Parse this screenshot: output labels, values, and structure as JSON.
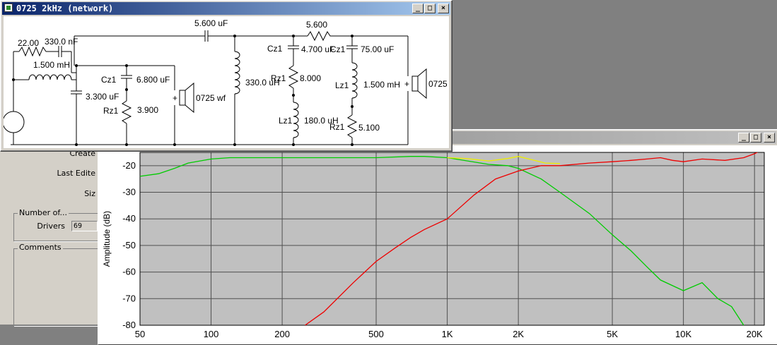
{
  "network_window": {
    "title": "0725 2kHz (network)",
    "buttons": {
      "minimize": "_",
      "maximize": "□",
      "close": "×"
    },
    "components": {
      "r1": "22.00",
      "c1": "330.0 nF",
      "l1": "1.500 mH",
      "c2": "3.300 uF",
      "cz1_wf_label": "Cz1",
      "cz1_wf": "6.800 uF",
      "rz1_wf_label": "Rz1",
      "rz1_wf": "3.900",
      "driver_wf": "0725 wf",
      "c_hp1": "5.600 uF",
      "l_hp": "330.0 uH",
      "r_att": "5.600",
      "cz1_tw_label": "Cz1",
      "cz1_tw": "4.700 uF",
      "rz1_tw_label": "Rz1",
      "rz1_tw": "8.000",
      "lz1_tw_label": "Lz1",
      "lz1_tw": "180.0 uH",
      "cz1b_label": "Cz1",
      "cz1b": "75.00 uF",
      "lz1b_label": "Lz1",
      "lz1b": "1.500 mH",
      "rz1b_label": "Rz1",
      "rz1b": "5.100",
      "driver_tw": "0725",
      "plus": "+"
    }
  },
  "props_panel": {
    "created_label": "Create",
    "last_edited_label": "Last Edite",
    "size_label": "Siz",
    "number_of_title": "Number of...",
    "drivers_label": "Drivers",
    "drivers_value": "69",
    "comments_title": "Comments"
  },
  "chart_window": {
    "buttons": {
      "minimize": "_",
      "maximize": "□",
      "close": "×"
    }
  },
  "chart_data": {
    "type": "line",
    "ylabel": "Amplitude (dB)",
    "xscale": "log",
    "xlim": [
      50,
      22000
    ],
    "ylim": [
      -80,
      -15
    ],
    "grid": true,
    "x_ticks": [
      50,
      100,
      200,
      500,
      1000,
      2000,
      5000,
      10000,
      20000
    ],
    "x_tick_labels": [
      "50",
      "100",
      "200",
      "500",
      "1K",
      "2K",
      "5K",
      "10K",
      "20K"
    ],
    "y_ticks": [
      -20,
      -30,
      -40,
      -50,
      -60,
      -70,
      -80
    ],
    "y_tick_labels": [
      "-20",
      "-30",
      "-40",
      "-50",
      "-60",
      "-70",
      "-80"
    ],
    "colors": {
      "plot_bg": "#c0c0c0",
      "grid": "#505050"
    },
    "series": [
      {
        "color": "#00cc00",
        "x": [
          50,
          60,
          70,
          80,
          100,
          120,
          150,
          200,
          300,
          500,
          700,
          800,
          1000,
          1500,
          1800,
          2000,
          2500,
          3000,
          4000,
          5000,
          6000,
          7000,
          8000,
          10000,
          12000,
          14000,
          16000,
          18000
        ],
        "y": [
          -24,
          -23,
          -21,
          -19,
          -17.5,
          -17,
          -17,
          -17,
          -17,
          -17,
          -16.5,
          -16.5,
          -17,
          -19.5,
          -20,
          -21,
          -25,
          -30,
          -38,
          -46,
          -52,
          -58,
          -63,
          -67,
          -64,
          -70,
          -73,
          -80
        ]
      },
      {
        "color": "#ee0000",
        "x": [
          250,
          300,
          400,
          500,
          600,
          700,
          800,
          1000,
          1300,
          1600,
          2000,
          2500,
          3000,
          4000,
          5000,
          6000,
          7000,
          8000,
          9000,
          10000,
          12000,
          15000,
          18000,
          20000,
          21000
        ],
        "y": [
          -80,
          -75,
          -64,
          -56,
          -51,
          -47,
          -44,
          -40,
          -31,
          -25,
          -22,
          -20,
          -20,
          -19,
          -18.5,
          -18,
          -17.5,
          -17,
          -18,
          -18.5,
          -17.5,
          -18,
          -17,
          -15.5,
          -14.5
        ]
      },
      {
        "color": "#eeee00",
        "x": [
          1000,
          1200,
          1500,
          1800,
          2000,
          2300,
          2600,
          3000
        ],
        "y": [
          -17,
          -17.3,
          -18.2,
          -17.3,
          -16.5,
          -17.8,
          -19,
          -19.2
        ]
      }
    ]
  }
}
